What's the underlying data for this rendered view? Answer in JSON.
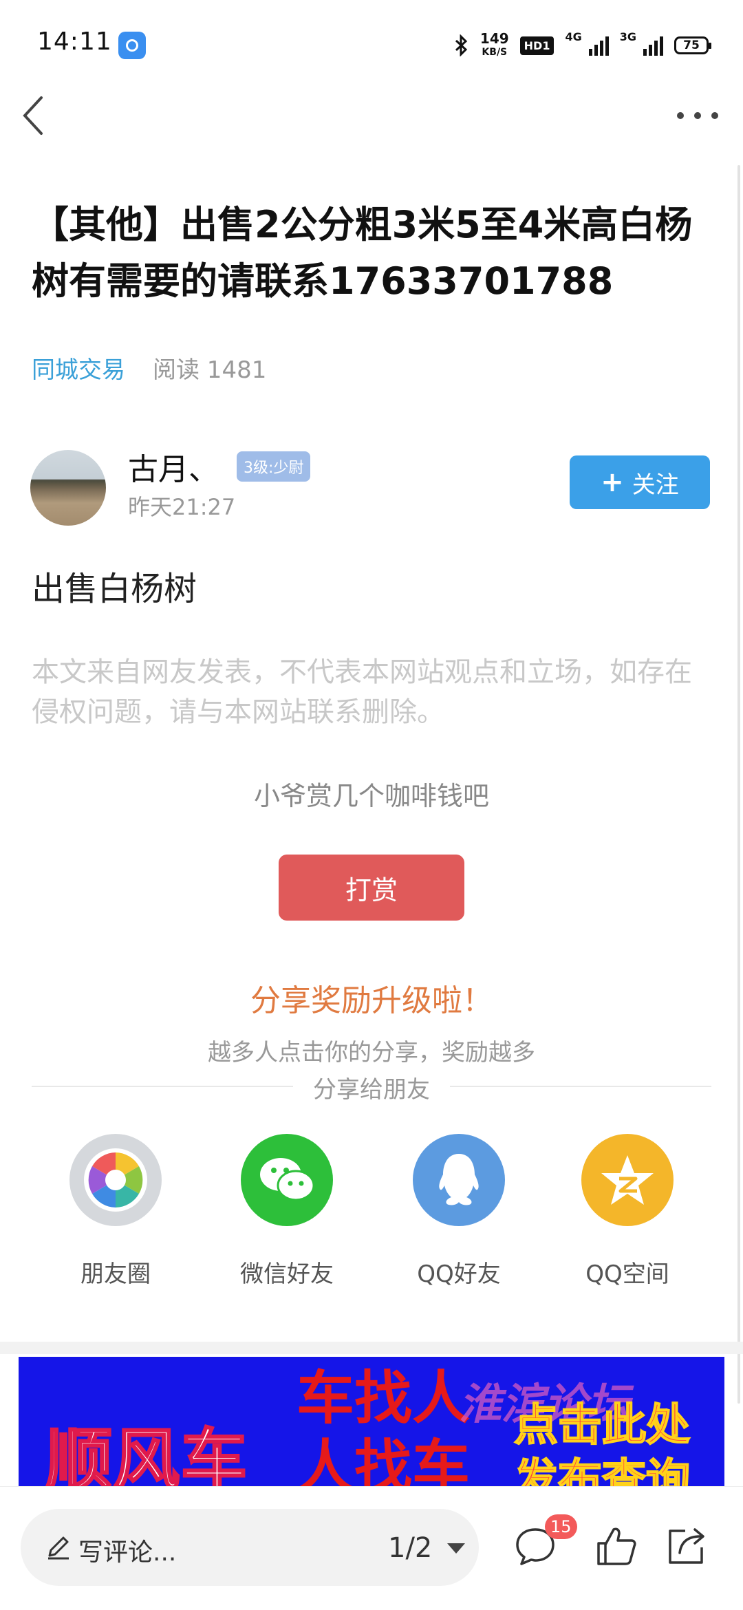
{
  "status_bar": {
    "time": "14:11",
    "net_speed": "149",
    "net_speed_unit": "KB/S",
    "hd_label": "HD1",
    "signal1_label": "4G",
    "signal2_label": "3G",
    "battery": "75"
  },
  "article": {
    "title": "【其他】出售2公分粗3米5至4米高白杨树有需要的请联系17633701788",
    "category": "同城交易",
    "reads": "阅读 1481",
    "body": "出售白杨树",
    "disclaimer": "本文来自网友发表，不代表本网站观点和立场，如存在侵权问题，请与本网站联系删除。"
  },
  "author": {
    "name": "古月、",
    "level": "3级:少尉",
    "time": "昨天21:27",
    "follow_label": "关注"
  },
  "reward": {
    "tip": "小爷赏几个咖啡钱吧",
    "button": "打赏"
  },
  "share": {
    "title": "分享奖励升级啦！",
    "subtitle": "越多人点击你的分享，奖励越多",
    "divider_label": "分享给朋友",
    "items": [
      {
        "label": "朋友圈",
        "icon": "moments-icon",
        "color": "#d5d8dc"
      },
      {
        "label": "微信好友",
        "icon": "wechat-icon",
        "color": "#2dbf3a"
      },
      {
        "label": "QQ好友",
        "icon": "qq-icon",
        "color": "#5c9be0"
      },
      {
        "label": "QQ空间",
        "icon": "qzone-icon",
        "color": "#f4b62a"
      }
    ]
  },
  "banner": {
    "main_text": "顺风车",
    "mid_text": "车找人 人找车",
    "watermark": "淮滨论坛",
    "right_text": "点击此处 发布查询"
  },
  "bottom_bar": {
    "comment_placeholder": "写评论...",
    "page_indicator": "1/2",
    "comment_count": "15"
  },
  "colors": {
    "accent_blue": "#3ba0e8",
    "reward_red": "#e05a5a",
    "share_orange": "#e07a40"
  }
}
